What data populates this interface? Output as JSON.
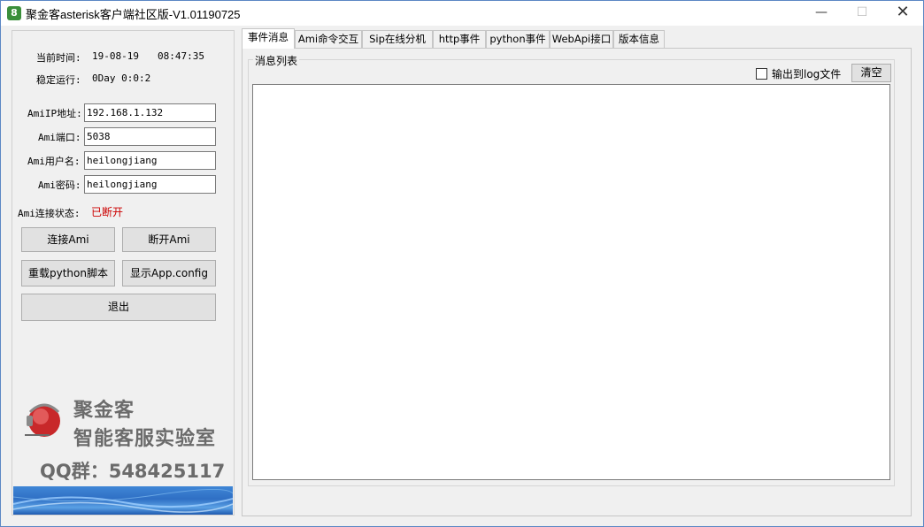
{
  "window": {
    "title": "聚金客asterisk客户端社区版-V1.01190725",
    "app_icon_glyph": "8",
    "minimize_glyph": "—",
    "maximize_glyph": "☐",
    "close_glyph": "✕"
  },
  "left_panel": {
    "time_label": "当前时间:",
    "date_value": "19-08-19",
    "time_value": "08:47:35",
    "uptime_label": "稳定运行:",
    "uptime_value": "0Day 0:0:2",
    "ip_label": "AmiIP地址:",
    "ip_value": "192.168.1.132",
    "port_label": "Ami端口:",
    "port_value": "5038",
    "user_label": "Ami用户名:",
    "user_value": "heilongjiang",
    "password_label": "Ami密码:",
    "password_value": "heilongjiang",
    "connection_label": "Ami连接状态:",
    "connection_status": "已断开",
    "connection_status_color": "#cc0000",
    "buttons": {
      "connect": "连接Ami",
      "disconnect": "断开Ami",
      "reload_python": "重载python脚本",
      "show_config": "显示App.config",
      "exit": "退出"
    },
    "logo": {
      "line1": "聚金客",
      "line2": "智能客服实验室",
      "qq": "QQ群：548425117"
    }
  },
  "tabs": [
    {
      "label": "事件消息",
      "active": true
    },
    {
      "label": "Ami命令交互",
      "active": false
    },
    {
      "label": "Sip在线分机",
      "active": false
    },
    {
      "label": "http事件",
      "active": false
    },
    {
      "label": "python事件",
      "active": false
    },
    {
      "label": "WebApi接口",
      "active": false
    },
    {
      "label": "版本信息",
      "active": false
    }
  ],
  "main": {
    "group_title": "消息列表",
    "checkbox_label": "输出到log文件",
    "checkbox_checked": false,
    "clear_button": "清空"
  }
}
